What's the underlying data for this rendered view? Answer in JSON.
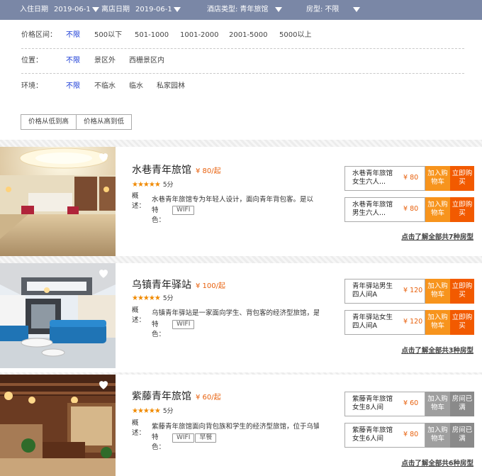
{
  "top_bar": {
    "checkin_label": "入住日期",
    "checkin_value": "2019-06-1",
    "checkout_label": "离店日期",
    "checkout_value": "2019-06-1",
    "hotel_type_label": "酒店类型:",
    "hotel_type_value": "青年旅馆",
    "room_type_label": "房型:",
    "room_type_value": "不限"
  },
  "filters": {
    "price": {
      "label": "价格区间：",
      "options": [
        "不限",
        "500以下",
        "501-1000",
        "1001-2000",
        "2001-5000",
        "5000以上"
      ],
      "selected": "不限"
    },
    "location": {
      "label": "位置：",
      "options": [
        "不限",
        "景区外",
        "西栅景区内"
      ],
      "selected": "不限"
    },
    "environment": {
      "label": "环境：",
      "options": [
        "不限",
        "不临水",
        "临水",
        "私家园林"
      ],
      "selected": "不限"
    }
  },
  "sort": {
    "low_to_high": "价格从低到高",
    "high_to_low": "价格从高到低"
  },
  "colors": {
    "top_bar_bg": "#7a87a6",
    "accent_price": "#e8600c",
    "cart_btn": "#f7941d",
    "buy_btn": "#f25a00",
    "soldout_btn": "#9f9f9f",
    "active_filter": "#1a3bd6",
    "stars": "#f08a00"
  },
  "hotels": [
    {
      "name": "水巷青年旅馆",
      "price": "¥ 80/起",
      "stars": "★★★★★",
      "score": "5分",
      "desc_label": "概述：",
      "desc": "水巷青年旅馆专为年轻人设计，面向青年背包客。是以",
      "features_label": "特色：",
      "tags": [
        "WIFI"
      ],
      "rooms": [
        {
          "name": "水巷青年旅馆女生六人...",
          "price": "¥ 80",
          "cart": "加入购物车",
          "buy": "立即购买",
          "soldout": false
        },
        {
          "name": "水巷青年旅馆男生六人...",
          "price": "¥ 80",
          "cart": "加入购物车",
          "buy": "立即购买",
          "soldout": false
        }
      ],
      "all_rooms_link": "点击了解全部共7种房型"
    },
    {
      "name": "乌镇青年驿站",
      "price": "¥ 100/起",
      "stars": "★★★★★",
      "score": "5分",
      "desc_label": "概述：",
      "desc": "乌镇青年驿站是一家面向学生、背包客的经济型旅馆，是",
      "features_label": "特色：",
      "tags": [
        "WIFI"
      ],
      "rooms": [
        {
          "name": "青年驿站男生四人间A",
          "price": "¥ 120",
          "cart": "加入购物车",
          "buy": "立即购买",
          "soldout": false
        },
        {
          "name": "青年驿站女生四人间A",
          "price": "¥ 120",
          "cart": "加入购物车",
          "buy": "立即购买",
          "soldout": false
        }
      ],
      "all_rooms_link": "点击了解全部共3种房型"
    },
    {
      "name": "紫藤青年旅馆",
      "price": "¥ 60/起",
      "stars": "★★★★★",
      "score": "5分",
      "desc_label": "概述：",
      "desc": "紫藤青年旅馆面向背包族和学生的经济型旅馆，位于乌镇",
      "features_label": "特色：",
      "tags": [
        "WIFI",
        "早餐"
      ],
      "rooms": [
        {
          "name": "紫藤青年旅馆女生8人间",
          "price": "¥ 60",
          "cart": "加入购物车",
          "buy": "房间已满",
          "soldout": true
        },
        {
          "name": "紫藤青年旅馆女生6人间",
          "price": "¥ 80",
          "cart": "加入购物车",
          "buy": "房间已满",
          "soldout": true
        }
      ],
      "all_rooms_link": "点击了解全部共6种房型"
    }
  ]
}
